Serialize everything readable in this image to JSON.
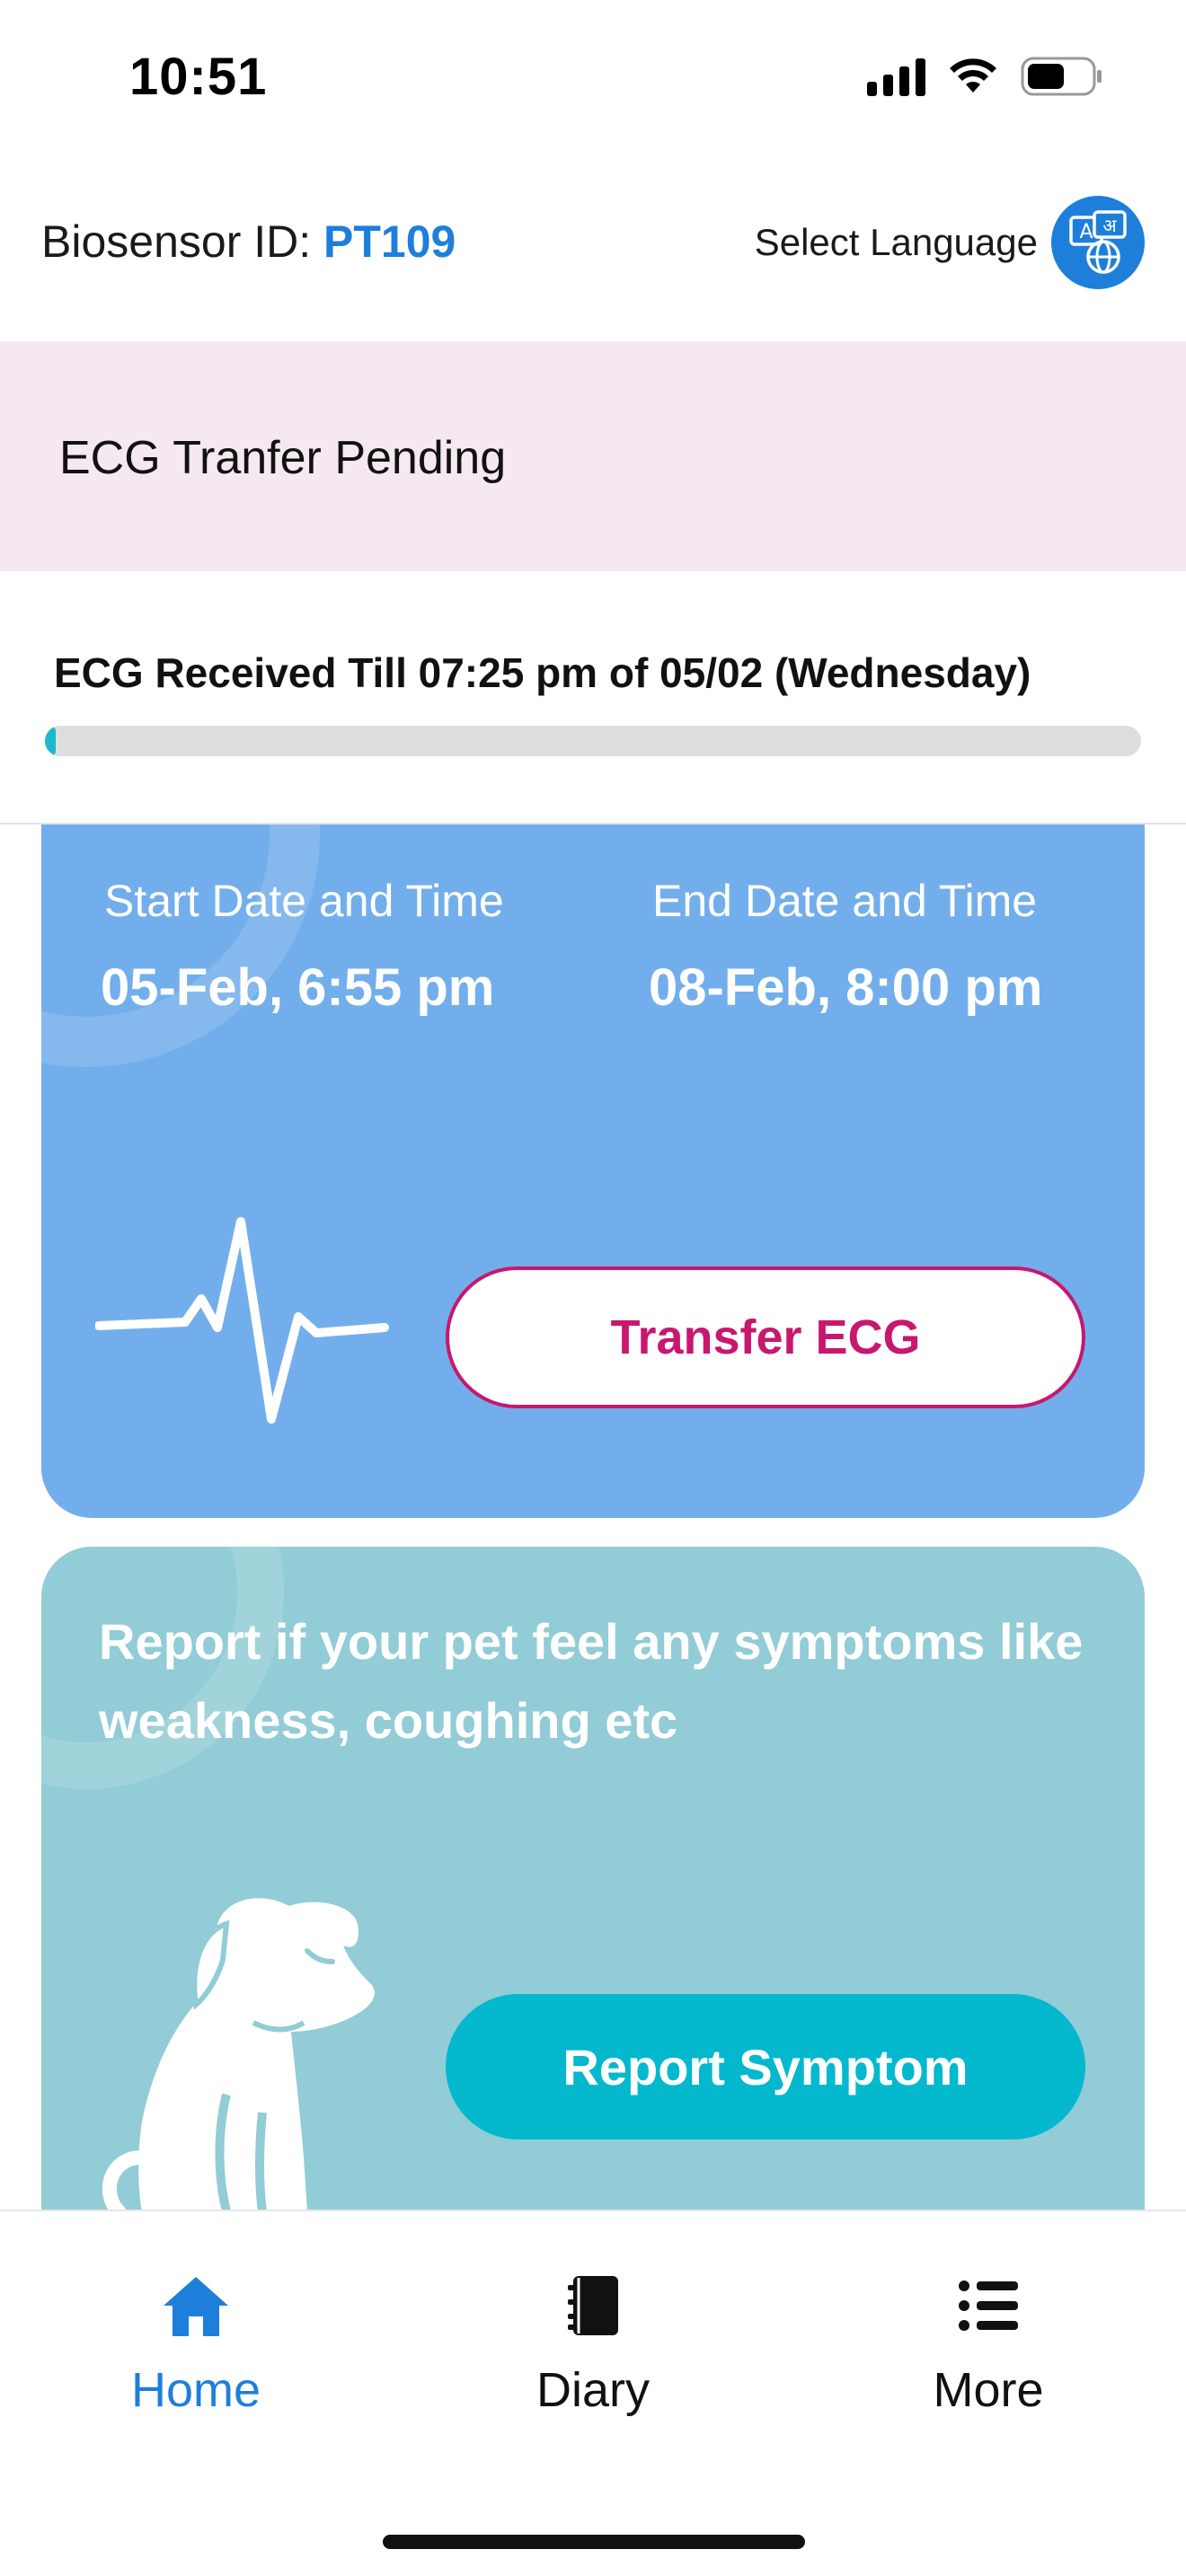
{
  "status_bar": {
    "time": "10:51"
  },
  "header": {
    "biosensor_label": "Biosensor ID: ",
    "biosensor_id": "PT109",
    "select_language": "Select Language"
  },
  "pending_banner": {
    "title": "ECG Tranfer Pending"
  },
  "received": {
    "text": "ECG Received Till 07:25 pm of 05/02 (Wednesday)",
    "progress_fraction": 0.01
  },
  "ecg_card": {
    "start_label": "Start Date and Time",
    "start_value": "05-Feb, 6:55 pm",
    "end_label": "End Date and Time",
    "end_value": "08-Feb, 8:00 pm",
    "transfer_button": "Transfer ECG"
  },
  "symptom_card": {
    "text": "Report if your pet feel any symptoms like\nweakness, coughing etc",
    "report_button": "Report Symptom"
  },
  "bottom_nav": {
    "items": [
      {
        "label": "Home",
        "icon": "home-icon",
        "active": true
      },
      {
        "label": "Diary",
        "icon": "diary-icon",
        "active": false
      },
      {
        "label": "More",
        "icon": "list-icon",
        "active": false
      }
    ]
  },
  "colors": {
    "accent_blue": "#1E7FDB",
    "pending_bg": "#F5E8F0",
    "ecg_card_bg": "#72AEEB",
    "transfer_accent": "#C8176F",
    "symptom_card_bg": "#92CCD6",
    "report_button_bg": "#04B8CE",
    "progress_fill": "#1CB8CC"
  }
}
